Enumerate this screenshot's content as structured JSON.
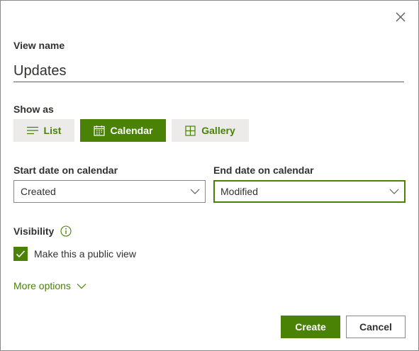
{
  "dialog": {
    "close_icon": "close-icon",
    "view_name": {
      "label": "View name",
      "value": "Updates"
    },
    "show_as": {
      "label": "Show as",
      "options": [
        {
          "label": "List",
          "icon": "list-icon",
          "selected": false
        },
        {
          "label": "Calendar",
          "icon": "calendar-icon",
          "selected": true
        },
        {
          "label": "Gallery",
          "icon": "gallery-icon",
          "selected": false
        }
      ]
    },
    "start_date": {
      "label": "Start date on calendar",
      "value": "Created"
    },
    "end_date": {
      "label": "End date on calendar",
      "value": "Modified"
    },
    "visibility": {
      "label": "Visibility",
      "info_icon": "info-icon",
      "checkbox_label": "Make this a public view",
      "checked": true
    },
    "more_options": {
      "label": "More options",
      "icon": "chevron-down-icon"
    },
    "buttons": {
      "create": "Create",
      "cancel": "Cancel"
    }
  },
  "colors": {
    "accent": "#498205",
    "neutral_button": "#edebe9",
    "text": "#323130",
    "border": "#8a8886"
  }
}
